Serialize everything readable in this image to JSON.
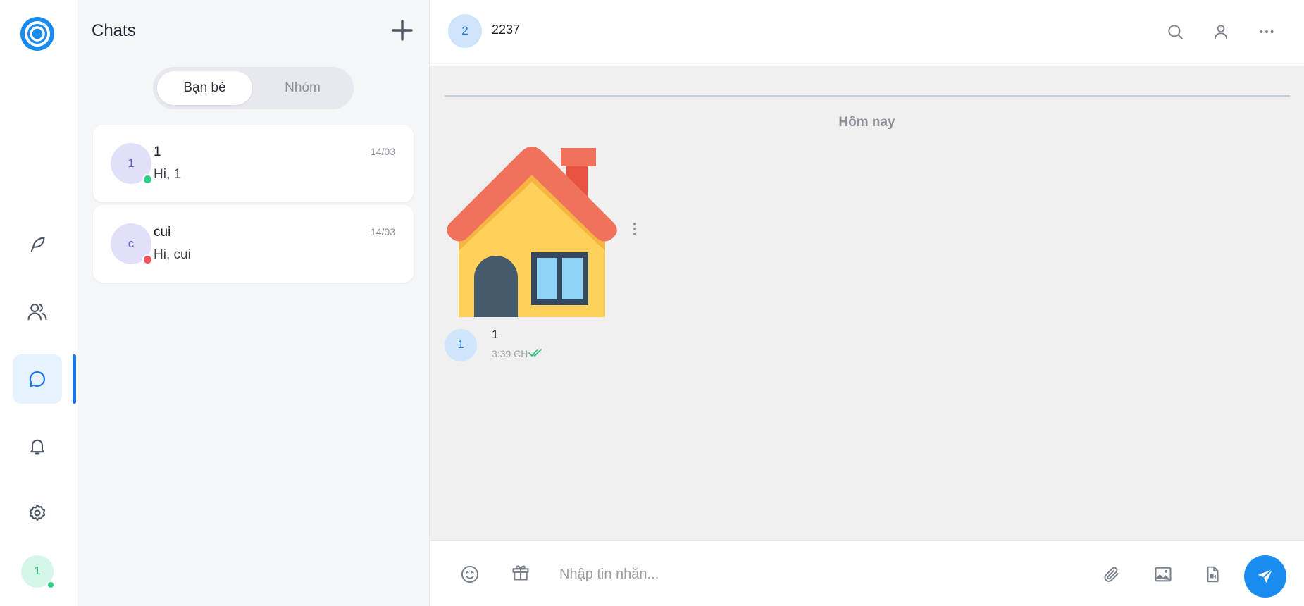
{
  "colors": {
    "accent": "#1a8cf0",
    "online": "#2fcf8a",
    "offline": "#f0505f",
    "active_nav_bg": "#e6f2fd"
  },
  "rail": {
    "logo": "app-logo",
    "nav": [
      {
        "id": "feed",
        "icon": "feather-icon",
        "active": false
      },
      {
        "id": "friends",
        "icon": "users-icon",
        "active": false
      },
      {
        "id": "chats",
        "icon": "chat-bubble-icon",
        "active": true
      },
      {
        "id": "notifications",
        "icon": "bell-icon",
        "active": false
      },
      {
        "id": "settings",
        "icon": "gear-icon",
        "active": false
      }
    ],
    "me": {
      "initial": "1",
      "status": "online"
    }
  },
  "list": {
    "title": "Chats",
    "add_icon": "plus-icon",
    "tabs": [
      {
        "label": "Bạn bè",
        "active": true
      },
      {
        "label": "Nhóm",
        "active": false
      }
    ],
    "conversations": [
      {
        "initial": "1",
        "name": "1",
        "preview": "Hi, 1",
        "date": "14/03",
        "status": "online"
      },
      {
        "initial": "c",
        "name": "cui",
        "preview": "Hi, cui",
        "date": "14/03",
        "status": "offline"
      }
    ]
  },
  "chat": {
    "header": {
      "initial": "2",
      "name": "2237",
      "icons": [
        "search-icon",
        "user-icon",
        "more-icon"
      ]
    },
    "day_separator": "Hôm nay",
    "messages": [
      {
        "type": "sticker",
        "sticker": "house-sticker",
        "sender_initial": "1",
        "sender": "1",
        "time": "3:39 CH",
        "read": true
      }
    ],
    "composer": {
      "placeholder": "Nhập tin nhắn...",
      "left_icons": [
        "emoji-icon",
        "gift-icon"
      ],
      "right_icons": [
        "paperclip-icon",
        "image-icon",
        "video-file-icon"
      ],
      "send_icon": "send-icon"
    }
  }
}
